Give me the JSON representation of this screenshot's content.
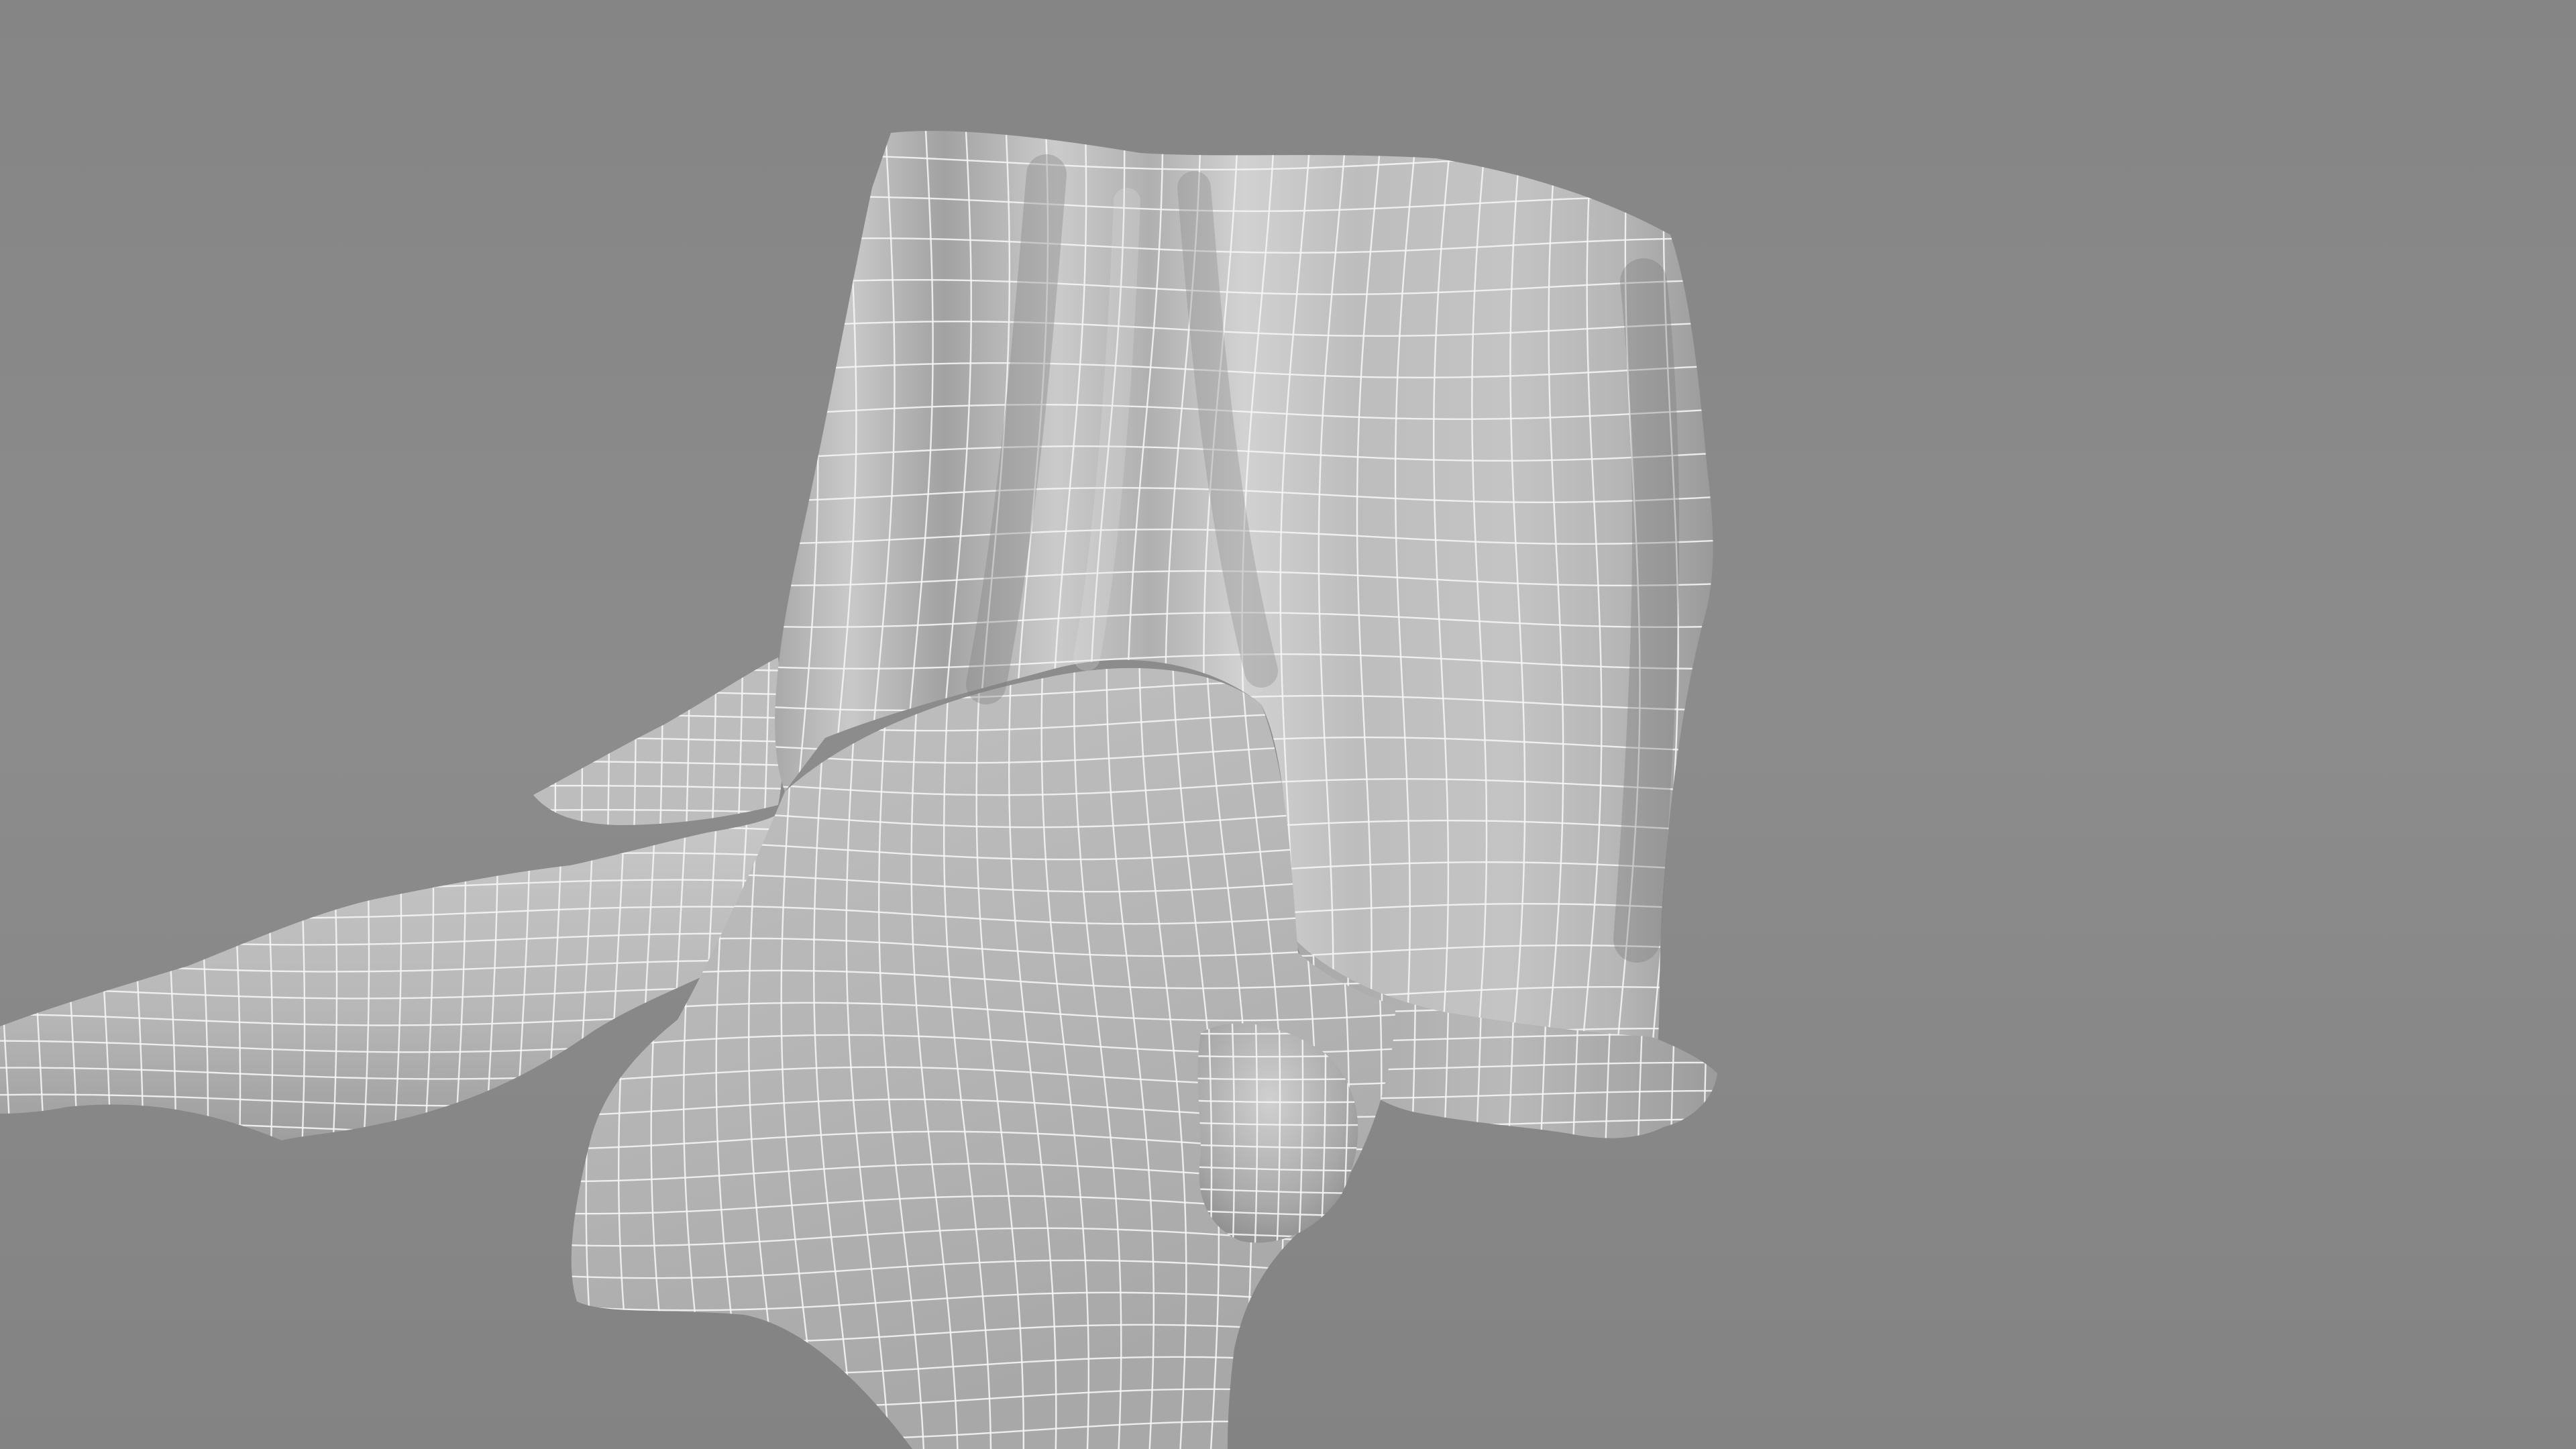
{
  "viewport": {
    "background_top": "#858585",
    "background_mid": "#8c8c8c",
    "background_bottom": "#838383"
  },
  "mesh": {
    "object": "draped-cloth-over-chair",
    "shading": "solid-gray",
    "surface_light": "#cfcfcf",
    "surface_mid": "#b4b4b4",
    "surface_shadow": "#8f8f8f",
    "wireframe_color": "#f4f4f4",
    "wireframe_visible": true
  }
}
